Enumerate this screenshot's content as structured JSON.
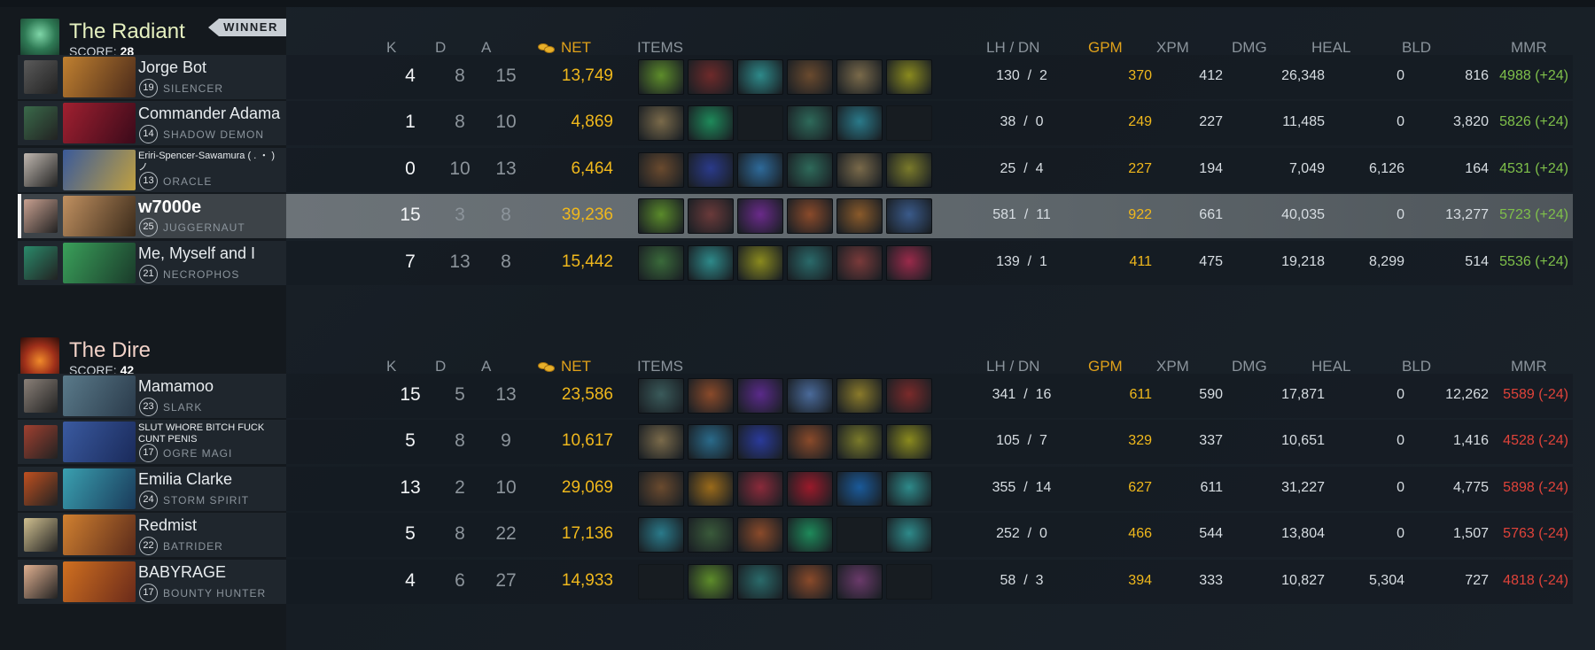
{
  "radiant": {
    "name": "The Radiant",
    "score_label": "SCORE:",
    "score": "28",
    "badge": "WINNER",
    "name_color": "#e6f1c0",
    "players": [
      {
        "name": "Jorge Bot",
        "level": "19",
        "hero": "SILENCER",
        "k": "4",
        "d": "8",
        "a": "15",
        "net": "13,749",
        "lh": "130",
        "dn": "2",
        "gpm": "370",
        "xpm": "412",
        "dmg": "26,348",
        "heal": "0",
        "bld": "816",
        "mmr": "4988 (+24)",
        "items": [
          "#5d8c2a",
          "#6e2a2a",
          "#2e8a8a",
          "#6a4a2e",
          "#7a6a4a",
          "#8a8a1e"
        ]
      },
      {
        "name": "Commander Adama",
        "level": "14",
        "hero": "SHADOW DEMON",
        "k": "1",
        "d": "8",
        "a": "10",
        "net": "4,869",
        "lh": "38",
        "dn": "0",
        "gpm": "249",
        "xpm": "227",
        "dmg": "11,485",
        "heal": "0",
        "bld": "3,820",
        "mmr": "5826 (+24)",
        "items": [
          "#7a6a4a",
          "#1e8a5a",
          "",
          "#2e6a5a",
          "#2a7a8a",
          ""
        ]
      },
      {
        "name": "Eriri-Spencer-Sawamura (  .  ・ ) ノ",
        "level": "13",
        "hero": "ORACLE",
        "k": "0",
        "d": "10",
        "a": "13",
        "net": "6,464",
        "lh": "25",
        "dn": "4",
        "gpm": "227",
        "xpm": "194",
        "dmg": "7,049",
        "heal": "6,126",
        "bld": "164",
        "mmr": "4531 (+24)",
        "items": [
          "#6a4a2e",
          "#2a3a8a",
          "#2e6a9a",
          "#2e6a5a",
          "#7a6a4a",
          "#7a7a2a"
        ]
      },
      {
        "name": "w7000e",
        "level": "25",
        "hero": "JUGGERNAUT",
        "k": "15",
        "d": "3",
        "a": "8",
        "net": "39,236",
        "lh": "581",
        "dn": "11",
        "gpm": "922",
        "xpm": "661",
        "dmg": "40,035",
        "heal": "0",
        "bld": "13,277",
        "mmr": "5723 (+24)",
        "items": [
          "#5a8a2a",
          "#6a3a3a",
          "#6a2a8a",
          "#8a4a2a",
          "#8a5a2a",
          "#3a5a8a"
        ]
      },
      {
        "name": "Me, Myself and I",
        "level": "21",
        "hero": "NECROPHOS",
        "k": "7",
        "d": "13",
        "a": "8",
        "net": "15,442",
        "lh": "139",
        "dn": "1",
        "gpm": "411",
        "xpm": "475",
        "dmg": "19,218",
        "heal": "8,299",
        "bld": "514",
        "mmr": "5536 (+24)",
        "items": [
          "#3a6a3a",
          "#2e8a8a",
          "#8a8a1e",
          "#2a6a6a",
          "#7a3a3a",
          "#9a2a4a"
        ]
      }
    ]
  },
  "dire": {
    "name": "The Dire",
    "score_label": "SCORE:",
    "score": "42",
    "name_color": "#f2d2c8",
    "players": [
      {
        "name": "Mamamoo",
        "level": "23",
        "hero": "SLARK",
        "k": "15",
        "d": "5",
        "a": "13",
        "net": "23,586",
        "lh": "341",
        "dn": "16",
        "gpm": "611",
        "xpm": "590",
        "dmg": "17,871",
        "heal": "0",
        "bld": "12,262",
        "mmr": "5589 (-24)",
        "items": [
          "#3a5a5a",
          "#8a4a2a",
          "#5a2a8a",
          "#4a6a9a",
          "#8a7a2a",
          "#7a2a2a"
        ]
      },
      {
        "name": "SLUT WHORE BITCH FUCK CUNT PENIS",
        "level": "17",
        "hero": "OGRE MAGI",
        "k": "5",
        "d": "8",
        "a": "9",
        "net": "10,617",
        "lh": "105",
        "dn": "7",
        "gpm": "329",
        "xpm": "337",
        "dmg": "10,651",
        "heal": "0",
        "bld": "1,416",
        "mmr": "4528 (-24)",
        "items": [
          "#7a6a4a",
          "#2a6a8a",
          "#2a3a9a",
          "#8a4a2a",
          "#7a7a2a",
          "#8a8a1e"
        ]
      },
      {
        "name": "Emilia Clarke",
        "level": "24",
        "hero": "STORM SPIRIT",
        "k": "13",
        "d": "2",
        "a": "10",
        "net": "29,069",
        "lh": "355",
        "dn": "14",
        "gpm": "627",
        "xpm": "611",
        "dmg": "31,227",
        "heal": "0",
        "bld": "4,775",
        "mmr": "5898 (-24)",
        "items": [
          "#6a4a2e",
          "#9a6a1a",
          "#8a2a3a",
          "#9a1a2a",
          "#1a5a9a",
          "#2e8a8a"
        ]
      },
      {
        "name": "Redmist",
        "level": "22",
        "hero": "BATRIDER",
        "k": "5",
        "d": "8",
        "a": "22",
        "net": "17,136",
        "lh": "252",
        "dn": "0",
        "gpm": "466",
        "xpm": "544",
        "dmg": "13,804",
        "heal": "0",
        "bld": "1,507",
        "mmr": "5763 (-24)",
        "items": [
          "#2a7a8a",
          "#3a5a3a",
          "#8a4a2a",
          "#1e8a5a",
          "",
          "#2e8a8a"
        ]
      },
      {
        "name": "BABYRAGE",
        "level": "17",
        "hero": "BOUNTY HUNTER",
        "k": "4",
        "d": "6",
        "a": "27",
        "net": "14,933",
        "lh": "58",
        "dn": "3",
        "gpm": "394",
        "xpm": "333",
        "dmg": "10,827",
        "heal": "5,304",
        "bld": "727",
        "mmr": "4818 (-24)",
        "items": [
          "",
          "#5d8c2a",
          "#2a6a6a",
          "#8a4a2a",
          "#6a3a6a",
          ""
        ]
      }
    ]
  },
  "columns": {
    "k": "K",
    "d": "D",
    "a": "A",
    "net": "NET",
    "items": "ITEMS",
    "lhdn": "LH  /  DN",
    "gpm": "GPM",
    "xpm": "XPM",
    "dmg": "DMG",
    "heal": "HEAL",
    "bld": "BLD",
    "mmr": "MMR"
  },
  "colors": {
    "gold": "#f0b81c",
    "mmr_up": "#7fc04a",
    "mmr_down": "#e0433a",
    "highlight_row": "#6c7378"
  }
}
